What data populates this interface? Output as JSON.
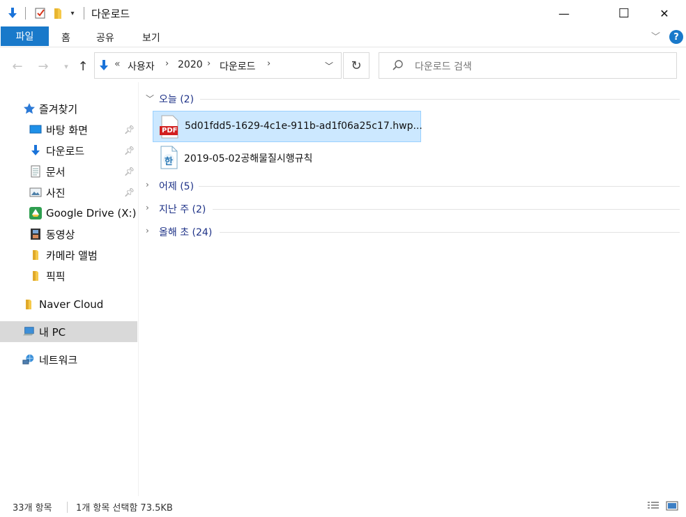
{
  "window": {
    "title": "다운로드",
    "minimize": "—",
    "maximize": "☐",
    "close": "✕"
  },
  "ribbon": {
    "file_tab": "파일",
    "tabs": [
      "홈",
      "공유",
      "보기"
    ],
    "help": "?"
  },
  "address": {
    "overflow": "«",
    "crumbs": [
      "사용자",
      "2020",
      "다운로드"
    ]
  },
  "search": {
    "placeholder": "다운로드 검색"
  },
  "sidebar": {
    "items": [
      {
        "label": "즐겨찾기",
        "icon": "star-icon"
      },
      {
        "label": "바탕 화면",
        "icon": "desktop-icon",
        "pinned": true
      },
      {
        "label": "다운로드",
        "icon": "download-arrow-icon",
        "pinned": true
      },
      {
        "label": "문서",
        "icon": "document-icon",
        "pinned": true
      },
      {
        "label": "사진",
        "icon": "picture-icon",
        "pinned": true
      },
      {
        "label": "Google Drive (X:)",
        "icon": "google-drive-icon"
      },
      {
        "label": "동영상",
        "icon": "video-icon"
      },
      {
        "label": "카메라 앨범",
        "icon": "folder-icon"
      },
      {
        "label": "픽픽",
        "icon": "folder-icon"
      },
      {
        "label": "Naver Cloud",
        "icon": "folder-icon"
      },
      {
        "label": "내 PC",
        "icon": "pc-icon"
      },
      {
        "label": "네트워크",
        "icon": "network-icon"
      }
    ]
  },
  "groups": [
    {
      "title": "오늘 (2)",
      "expanded": true
    },
    {
      "title": "어제 (5)",
      "expanded": false
    },
    {
      "title": "지난 주 (2)",
      "expanded": false
    },
    {
      "title": "올해 초 (24)",
      "expanded": false
    }
  ],
  "files": [
    {
      "name": "5d01fdd5-1629-4c1e-911b-ad1f06a25c17.hwp...",
      "icon": "pdf-file-icon",
      "icon_text": "PDF",
      "selected": true
    },
    {
      "name": "2019-05-02공해물질시행규칙",
      "icon": "hwp-file-icon",
      "icon_text": "한",
      "selected": false
    }
  ],
  "status": {
    "count": "33개 항목",
    "selection": "1개 항목 선택함 73.5KB"
  },
  "colors": {
    "accent": "#1979ca",
    "selected_bg": "#cce8ff",
    "group_title": "#1e3287"
  }
}
